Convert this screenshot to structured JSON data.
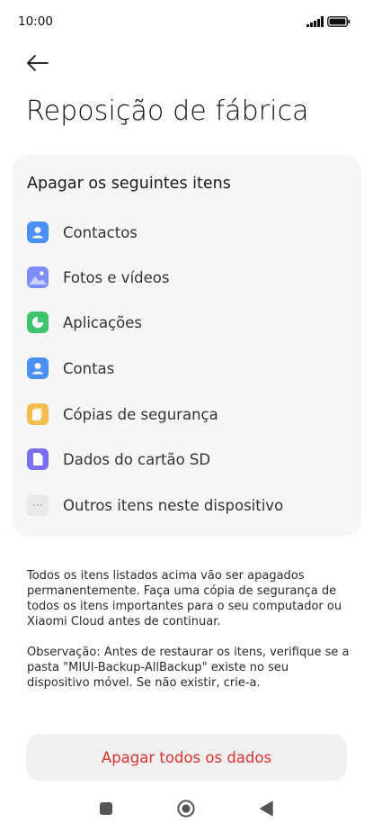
{
  "status_bar": {
    "time": "10:00"
  },
  "header": {
    "back_icon": "back-arrow-icon",
    "title": "Reposição de fábrica"
  },
  "card": {
    "heading": "Apagar os seguintes itens",
    "items": [
      {
        "label": "Contactos",
        "icon": "contacts-icon",
        "color": "#4a90f5"
      },
      {
        "label": "Fotos e vídeos",
        "icon": "gallery-icon",
        "color": "#7d8cf6"
      },
      {
        "label": "Aplicações",
        "icon": "apps-pie-icon",
        "color": "#3ec46d"
      },
      {
        "label": "Contas",
        "icon": "account-icon",
        "color": "#4a90f5"
      },
      {
        "label": "Cópias de segurança",
        "icon": "backup-icon",
        "color": "#f5bd4f"
      },
      {
        "label": "Dados do cartão SD",
        "icon": "sd-card-icon",
        "color": "#7a6ff0"
      },
      {
        "label": "Outros itens neste dispositivo",
        "icon": "more-icon",
        "color": "#e9e9e9"
      }
    ]
  },
  "notes": {
    "warning": "Todos os itens listados acima vão ser apagados permanentemente. Faça uma cópia de segurança de todos os itens importantes para o seu computador ou Xiaomi Cloud antes de continuar.",
    "observation": "Observação: Antes de restaurar os itens, verifique se a pasta \"MIUI-Backup-AllBackup\" existe no seu dispositivo móvel. Se não existir, crie-a."
  },
  "action": {
    "label": "Apagar todos os dados",
    "color": "#dd3131"
  },
  "nav_bar": {
    "icons": [
      "recents-square-icon",
      "home-circle-icon",
      "back-triangle-icon"
    ]
  }
}
